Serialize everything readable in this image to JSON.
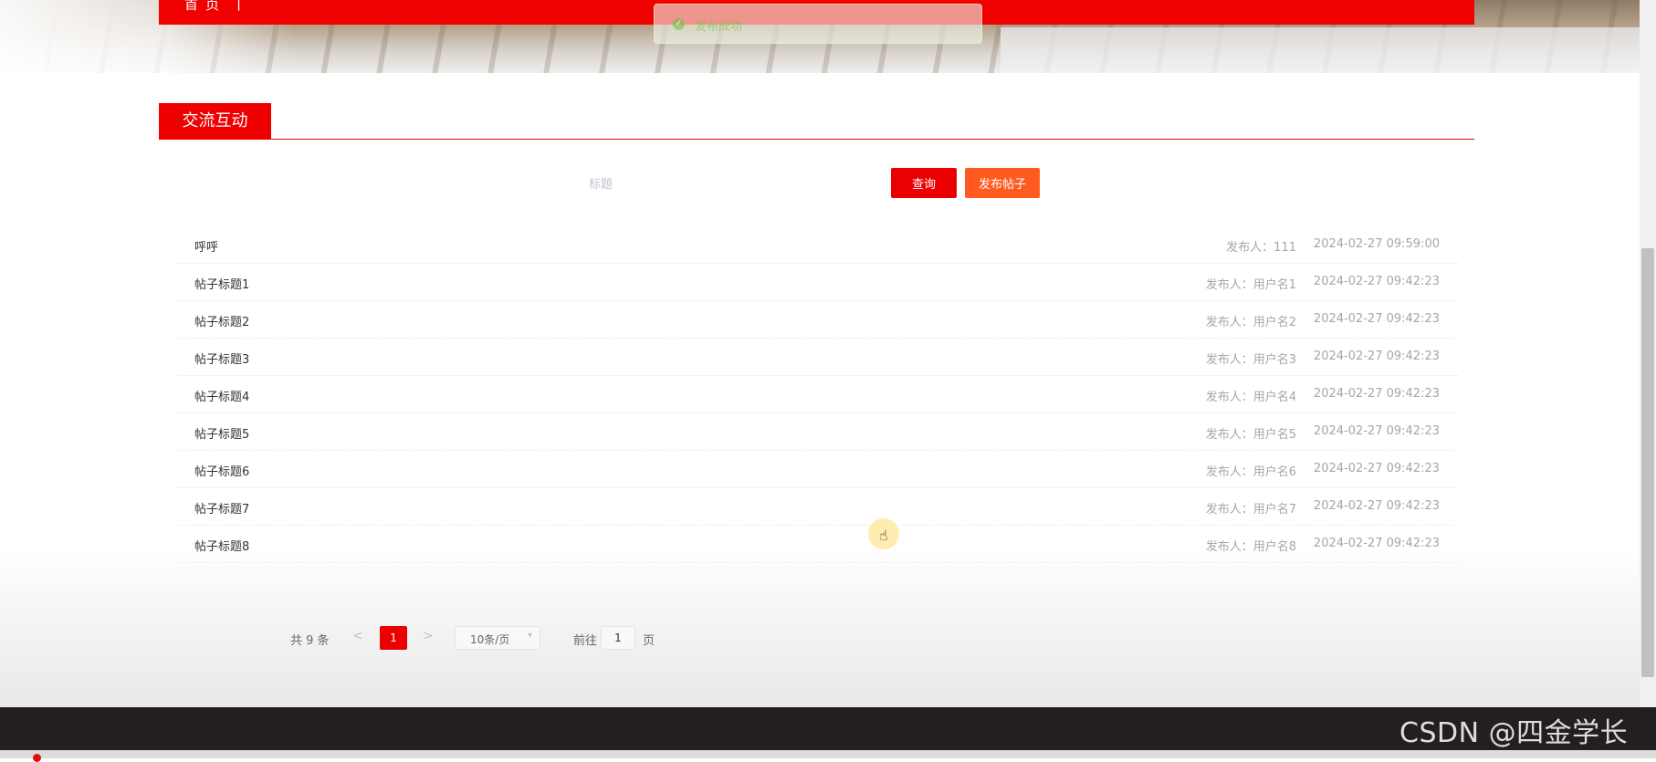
{
  "nav": {
    "home_label": "首页",
    "separator": "|"
  },
  "toast": {
    "icon": "check-circle-icon",
    "message": "发布成功"
  },
  "section": {
    "title": "交流互动"
  },
  "search": {
    "placeholder": "标题",
    "value": ""
  },
  "buttons": {
    "query": "查询",
    "post": "发布帖子"
  },
  "posts": [
    {
      "title": "呼呼",
      "author": "发布人：111",
      "time": "2024-02-27 09:59:00"
    },
    {
      "title": "帖子标题1",
      "author": "发布人：用户名1",
      "time": "2024-02-27 09:42:23"
    },
    {
      "title": "帖子标题2",
      "author": "发布人：用户名2",
      "time": "2024-02-27 09:42:23"
    },
    {
      "title": "帖子标题3",
      "author": "发布人：用户名3",
      "time": "2024-02-27 09:42:23"
    },
    {
      "title": "帖子标题4",
      "author": "发布人：用户名4",
      "time": "2024-02-27 09:42:23"
    },
    {
      "title": "帖子标题5",
      "author": "发布人：用户名5",
      "time": "2024-02-27 09:42:23"
    },
    {
      "title": "帖子标题6",
      "author": "发布人：用户名6",
      "time": "2024-02-27 09:42:23"
    },
    {
      "title": "帖子标题7",
      "author": "发布人：用户名7",
      "time": "2024-02-27 09:42:23"
    },
    {
      "title": "帖子标题8",
      "author": "发布人：用户名8",
      "time": "2024-02-27 09:42:23"
    }
  ],
  "pagination": {
    "total": "共 9 条",
    "prev": "<",
    "current_page": "1",
    "next": ">",
    "page_size": "10条/页",
    "goto_prefix": "前往",
    "goto_value": "1",
    "goto_suffix": "页"
  },
  "watermark": "CSDN @四金学长",
  "colors": {
    "primary_red": "#ea0000",
    "post_orange": "#ff5a1f",
    "footer": "#231f1f"
  }
}
